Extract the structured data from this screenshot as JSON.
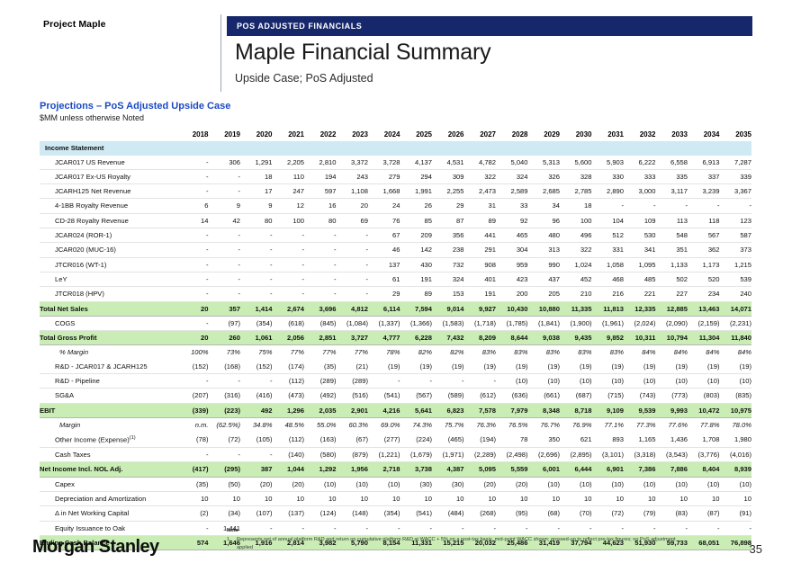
{
  "header": {
    "project_name": "Project Maple",
    "kicker": "POS ADJUSTED FINANCIALS",
    "title": "Maple Financial Summary",
    "subtitle": "Upside Case; PoS Adjusted",
    "band_color": "#16276b"
  },
  "section": {
    "title": "Projections – PoS Adjusted Upside Case",
    "units": "$MM unless otherwise Noted",
    "title_color": "#1a49c4"
  },
  "table": {
    "label_header": "",
    "years": [
      "2018",
      "2019",
      "2020",
      "2021",
      "2022",
      "2023",
      "2024",
      "2025",
      "2026",
      "2027",
      "2028",
      "2029",
      "2030",
      "2031",
      "2032",
      "2033",
      "2034",
      "2035"
    ],
    "rows": [
      {
        "type": "section",
        "label": "Income Statement",
        "values": [
          "",
          "",
          "",
          "",
          "",
          "",
          "",
          "",
          "",
          "",
          "",
          "",
          "",
          "",
          "",
          "",
          "",
          ""
        ]
      },
      {
        "type": "detail",
        "label": "JCAR017 US Revenue",
        "values": [
          "-",
          "306",
          "1,291",
          "2,205",
          "2,810",
          "3,372",
          "3,728",
          "4,137",
          "4,531",
          "4,782",
          "5,040",
          "5,313",
          "5,600",
          "5,903",
          "6,222",
          "6,558",
          "6,913",
          "7,287"
        ]
      },
      {
        "type": "detail",
        "label": "JCAR017 Ex-US Royalty",
        "values": [
          "-",
          "-",
          "18",
          "110",
          "194",
          "243",
          "279",
          "294",
          "309",
          "322",
          "324",
          "326",
          "328",
          "330",
          "333",
          "335",
          "337",
          "339"
        ]
      },
      {
        "type": "detail",
        "label": "JCARH125 Net Revenue",
        "values": [
          "-",
          "-",
          "17",
          "247",
          "597",
          "1,108",
          "1,668",
          "1,991",
          "2,255",
          "2,473",
          "2,589",
          "2,685",
          "2,785",
          "2,890",
          "3,000",
          "3,117",
          "3,239",
          "3,367"
        ]
      },
      {
        "type": "detail",
        "label": "4-1BB Royalty Revenue",
        "values": [
          "6",
          "9",
          "9",
          "12",
          "16",
          "20",
          "24",
          "26",
          "29",
          "31",
          "33",
          "34",
          "18",
          "-",
          "-",
          "-",
          "-",
          "-"
        ]
      },
      {
        "type": "detail",
        "label": "CD-28 Royalty Revenue",
        "values": [
          "14",
          "42",
          "80",
          "100",
          "80",
          "69",
          "76",
          "85",
          "87",
          "89",
          "92",
          "96",
          "100",
          "104",
          "109",
          "113",
          "118",
          "123"
        ]
      },
      {
        "type": "detail",
        "label": "JCAR024 (ROR-1)",
        "values": [
          "-",
          "-",
          "-",
          "-",
          "-",
          "-",
          "67",
          "209",
          "356",
          "441",
          "465",
          "480",
          "496",
          "512",
          "530",
          "548",
          "567",
          "587"
        ]
      },
      {
        "type": "detail",
        "label": "JCAR020 (MUC-16)",
        "values": [
          "-",
          "-",
          "-",
          "-",
          "-",
          "-",
          "46",
          "142",
          "238",
          "291",
          "304",
          "313",
          "322",
          "331",
          "341",
          "351",
          "362",
          "373"
        ]
      },
      {
        "type": "detail",
        "label": "JTCR016 (WT-1)",
        "values": [
          "-",
          "-",
          "-",
          "-",
          "-",
          "-",
          "137",
          "430",
          "732",
          "908",
          "959",
          "990",
          "1,024",
          "1,058",
          "1,095",
          "1,133",
          "1,173",
          "1,215"
        ]
      },
      {
        "type": "detail",
        "label": "LeY",
        "values": [
          "-",
          "-",
          "-",
          "-",
          "-",
          "-",
          "61",
          "191",
          "324",
          "401",
          "423",
          "437",
          "452",
          "468",
          "485",
          "502",
          "520",
          "539"
        ]
      },
      {
        "type": "detail",
        "label": "JTCR018 (HPV)",
        "values": [
          "-",
          "-",
          "-",
          "-",
          "-",
          "-",
          "29",
          "89",
          "153",
          "191",
          "200",
          "205",
          "210",
          "216",
          "221",
          "227",
          "234",
          "240"
        ]
      },
      {
        "type": "total",
        "label": "Total Net Sales",
        "values": [
          "20",
          "357",
          "1,414",
          "2,674",
          "3,696",
          "4,812",
          "6,114",
          "7,594",
          "9,014",
          "9,927",
          "10,430",
          "10,880",
          "11,335",
          "11,813",
          "12,335",
          "12,885",
          "13,463",
          "14,071"
        ]
      },
      {
        "type": "detail",
        "label": "COGS",
        "values": [
          "-",
          "(97)",
          "(354)",
          "(618)",
          "(845)",
          "(1,084)",
          "(1,337)",
          "(1,366)",
          "(1,583)",
          "(1,718)",
          "(1,785)",
          "(1,841)",
          "(1,900)",
          "(1,961)",
          "(2,024)",
          "(2,090)",
          "(2,159)",
          "(2,231)"
        ]
      },
      {
        "type": "total",
        "label": "Total Gross Profit",
        "values": [
          "20",
          "260",
          "1,061",
          "2,056",
          "2,851",
          "3,727",
          "4,777",
          "6,228",
          "7,432",
          "8,209",
          "8,644",
          "9,038",
          "9,435",
          "9,852",
          "10,311",
          "10,794",
          "11,304",
          "11,840"
        ]
      },
      {
        "type": "italic",
        "label": "% Margin",
        "values": [
          "100%",
          "73%",
          "75%",
          "77%",
          "77%",
          "77%",
          "78%",
          "82%",
          "82%",
          "83%",
          "83%",
          "83%",
          "83%",
          "83%",
          "84%",
          "84%",
          "84%",
          "84%"
        ]
      },
      {
        "type": "detail",
        "label": "R&D - JCAR017 & JCARH125",
        "values": [
          "(152)",
          "(168)",
          "(152)",
          "(174)",
          "(35)",
          "(21)",
          "(19)",
          "(19)",
          "(19)",
          "(19)",
          "(19)",
          "(19)",
          "(19)",
          "(19)",
          "(19)",
          "(19)",
          "(19)",
          "(19)"
        ]
      },
      {
        "type": "detail",
        "label": "R&D - Pipeline",
        "values": [
          "-",
          "-",
          "-",
          "(112)",
          "(289)",
          "(289)",
          "-",
          "-",
          "-",
          "-",
          "(10)",
          "(10)",
          "(10)",
          "(10)",
          "(10)",
          "(10)",
          "(10)",
          "(10)"
        ]
      },
      {
        "type": "detail",
        "label": "SG&A",
        "values": [
          "(207)",
          "(316)",
          "(416)",
          "(473)",
          "(492)",
          "(516)",
          "(541)",
          "(567)",
          "(589)",
          "(612)",
          "(636)",
          "(661)",
          "(687)",
          "(715)",
          "(743)",
          "(773)",
          "(803)",
          "(835)"
        ]
      },
      {
        "type": "total",
        "label": "EBIT",
        "values": [
          "(339)",
          "(223)",
          "492",
          "1,296",
          "2,035",
          "2,901",
          "4,216",
          "5,641",
          "6,823",
          "7,578",
          "7,979",
          "8,348",
          "8,718",
          "9,109",
          "9,539",
          "9,993",
          "10,472",
          "10,975"
        ]
      },
      {
        "type": "italic",
        "label": "Margin",
        "values": [
          "n.m.",
          "(62.5%)",
          "34.8%",
          "48.5%",
          "55.0%",
          "60.3%",
          "69.0%",
          "74.3%",
          "75.7%",
          "76.3%",
          "76.5%",
          "76.7%",
          "76.9%",
          "77.1%",
          "77.3%",
          "77.6%",
          "77.8%",
          "78.0%"
        ]
      },
      {
        "type": "detail",
        "label": "Other Income (Expense)",
        "footnote": "(1)",
        "values": [
          "(78)",
          "(72)",
          "(105)",
          "(112)",
          "(163)",
          "(67)",
          "(277)",
          "(224)",
          "(465)",
          "(194)",
          "78",
          "350",
          "621",
          "893",
          "1,165",
          "1,436",
          "1,708",
          "1,980"
        ]
      },
      {
        "type": "detail",
        "label": "Cash Taxes",
        "values": [
          "-",
          "-",
          "-",
          "(140)",
          "(580)",
          "(879)",
          "(1,221)",
          "(1,679)",
          "(1,971)",
          "(2,289)",
          "(2,498)",
          "(2,696)",
          "(2,895)",
          "(3,101)",
          "(3,318)",
          "(3,543)",
          "(3,776)",
          "(4,016)"
        ]
      },
      {
        "type": "total",
        "label": "Net Income Incl. NOL Adj.",
        "values": [
          "(417)",
          "(295)",
          "387",
          "1,044",
          "1,292",
          "1,956",
          "2,718",
          "3,738",
          "4,387",
          "5,095",
          "5,559",
          "6,001",
          "6,444",
          "6,901",
          "7,386",
          "7,886",
          "8,404",
          "8,939"
        ]
      },
      {
        "type": "detail",
        "label": "Capex",
        "values": [
          "(35)",
          "(50)",
          "(20)",
          "(20)",
          "(10)",
          "(10)",
          "(10)",
          "(30)",
          "(30)",
          "(20)",
          "(20)",
          "(10)",
          "(10)",
          "(10)",
          "(10)",
          "(10)",
          "(10)",
          "(10)"
        ]
      },
      {
        "type": "detail",
        "label": "Depreciation and Amortization",
        "values": [
          "10",
          "10",
          "10",
          "10",
          "10",
          "10",
          "10",
          "10",
          "10",
          "10",
          "10",
          "10",
          "10",
          "10",
          "10",
          "10",
          "10",
          "10"
        ]
      },
      {
        "type": "detail",
        "label": "Δ in Net Working Capital",
        "values": [
          "(2)",
          "(34)",
          "(107)",
          "(137)",
          "(124)",
          "(148)",
          "(354)",
          "(541)",
          "(484)",
          "(268)",
          "(95)",
          "(68)",
          "(70)",
          "(72)",
          "(79)",
          "(83)",
          "(87)",
          "(91)"
        ]
      },
      {
        "type": "detail",
        "label": "Equity Issuance to Oak",
        "values": [
          "-",
          "1,441",
          "-",
          "-",
          "-",
          "-",
          "-",
          "-",
          "-",
          "-",
          "-",
          "-",
          "-",
          "-",
          "-",
          "-",
          "-",
          "-"
        ]
      },
      {
        "type": "final",
        "label": "Ending Cash Balance",
        "values": [
          "574",
          "1,646",
          "1,916",
          "2,814",
          "3,982",
          "5,790",
          "8,154",
          "11,331",
          "15,215",
          "20,032",
          "25,486",
          "31,419",
          "37,794",
          "44,623",
          "51,930",
          "59,733",
          "68,051",
          "76,898"
        ]
      }
    ],
    "colors": {
      "section_row": "#cfeaf3",
      "total_row": "#c9edb4"
    }
  },
  "notes": {
    "heading": "Note",
    "items": [
      {
        "num": "1.",
        "text": "Represents net of annual platform R&D and return on cumulative platform R&D at WACC + 5% on a post-tax basis, mid-point WACC shown; grossed-up to reflect pre-tax figures; no PoS adjustment applied"
      }
    ]
  },
  "footer": {
    "logo": "Morgan Stanley",
    "page_number": "35"
  }
}
